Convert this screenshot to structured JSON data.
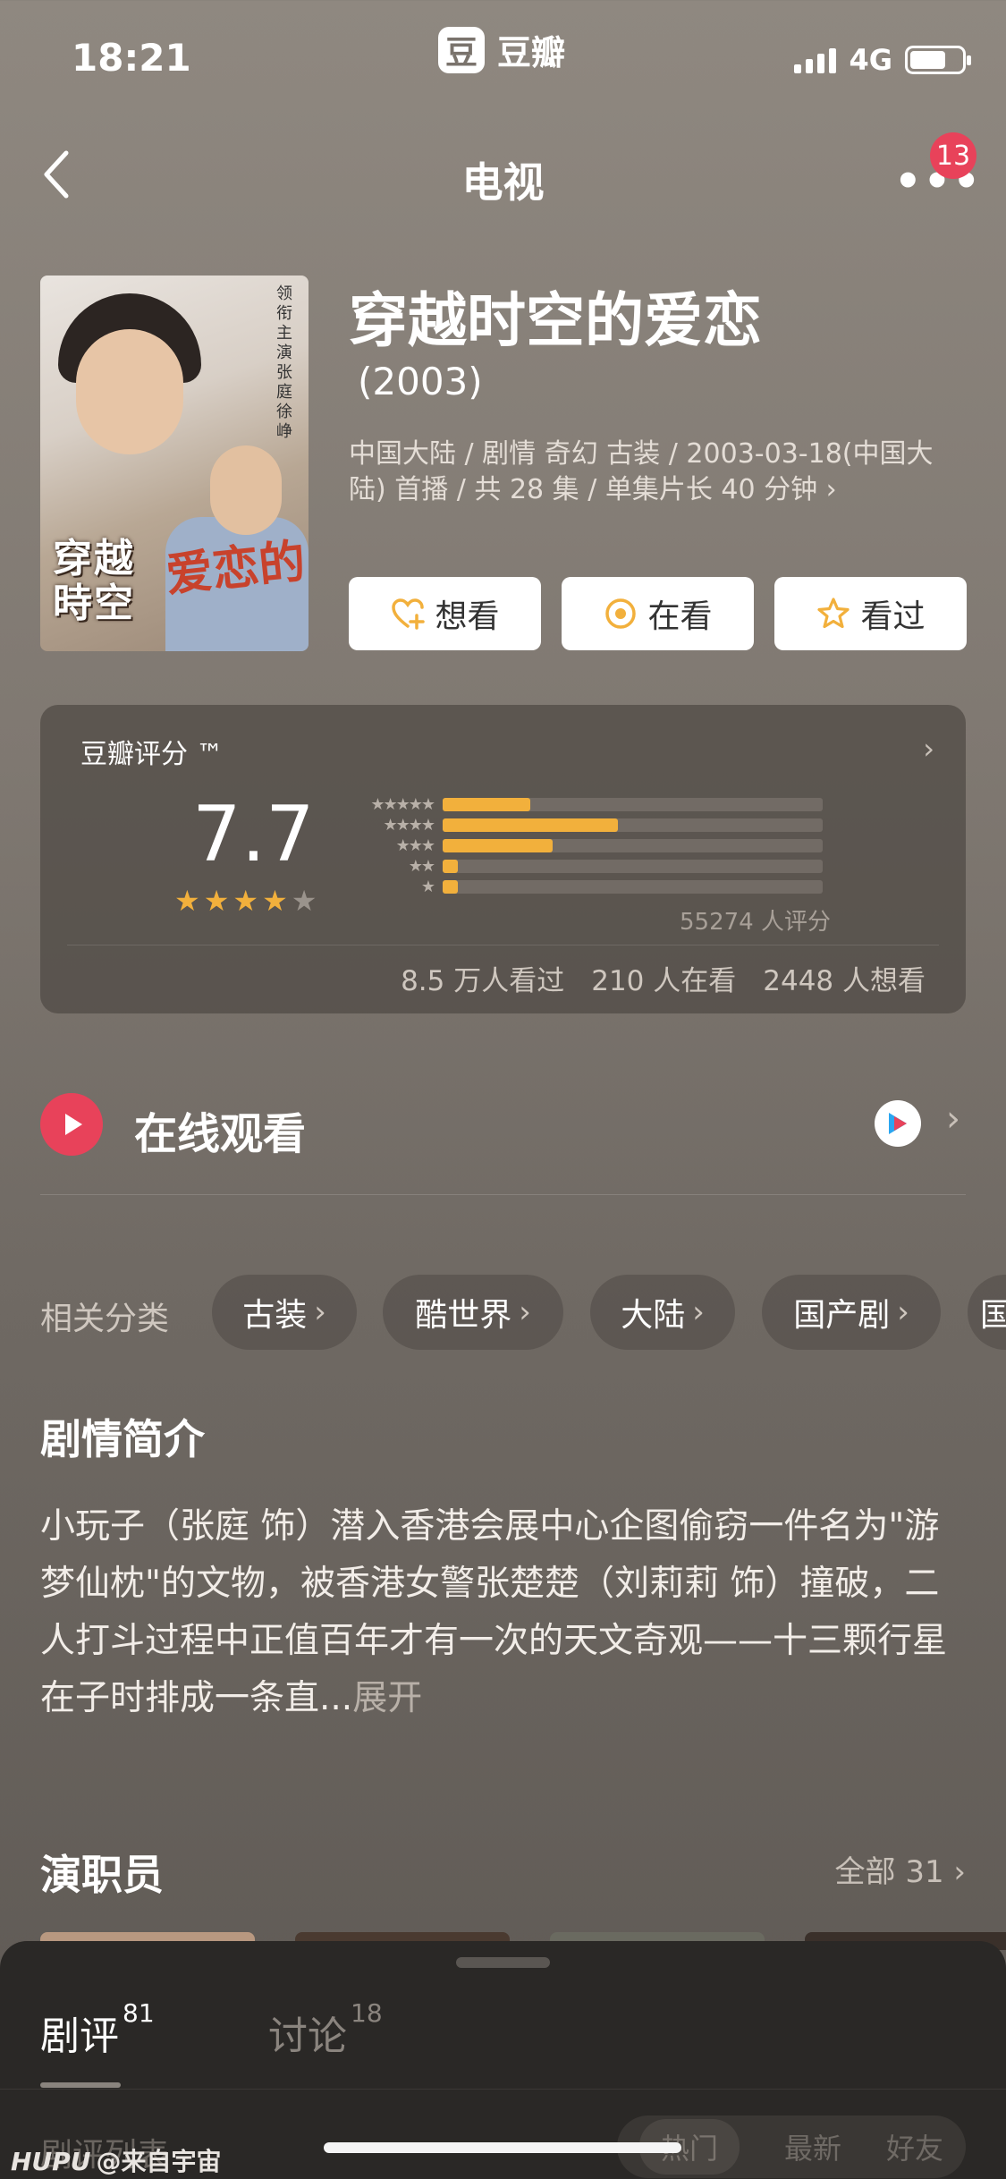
{
  "status_bar": {
    "time": "18:21",
    "app_logo_char": "豆",
    "app_name": "豆瓣",
    "network": "4G"
  },
  "nav": {
    "title": "电视",
    "more": "•••",
    "badge": "13"
  },
  "show": {
    "poster_title_line1": "穿越",
    "poster_title_line2": "時空",
    "poster_title_art": "爱恋的",
    "poster_side_text": "领衔主演 张庭 徐峥",
    "title": "穿越时空的爱恋",
    "year": "(2003)",
    "meta": "中国大陆 / 剧情 奇幻 古装 / 2003-03-18(中国大陆) 首播 / 共 28 集 / 单集片长 40 分钟 ›"
  },
  "actions": {
    "want": "想看",
    "watching": "在看",
    "watched": "看过"
  },
  "rating": {
    "label": "豆瓣评分 ™",
    "score": "7.7",
    "stars": 4,
    "distribution": [
      0.23,
      0.46,
      0.29,
      0.04,
      0.04
    ],
    "count": "55274 人评分",
    "stats": [
      "8.5 万人看过",
      "210 人在看",
      "2448 人想看"
    ],
    "colors": {
      "accent": "#f2b03c"
    }
  },
  "online": {
    "title": "在线观看",
    "provider": "youku"
  },
  "categories": {
    "label": "相关分类",
    "items": [
      "古装",
      "酷世界",
      "大陆",
      "国产剧",
      "国"
    ]
  },
  "synopsis": {
    "title": "剧情简介",
    "text": "小玩子（张庭 饰）潜入香港会展中心企图偷窃一件名为\"游梦仙枕\"的文物，被香港女警张楚楚（刘莉莉 饰）撞破，二人打斗过程中正值百年才有一次的天文奇观——十三颗行星在子时排成一条直...",
    "more": "展开"
  },
  "cast": {
    "title": "演职员",
    "all": "全部 31 ›"
  },
  "sheet": {
    "tab_reviews": "剧评",
    "tab_reviews_count": "81",
    "tab_discuss": "讨论",
    "tab_discuss_count": "18",
    "list_label": "剧评列表",
    "sort": [
      "热门",
      "最新",
      "好友"
    ]
  },
  "watermark": {
    "brand": "HUPU",
    "text": "@来自宇宙"
  }
}
